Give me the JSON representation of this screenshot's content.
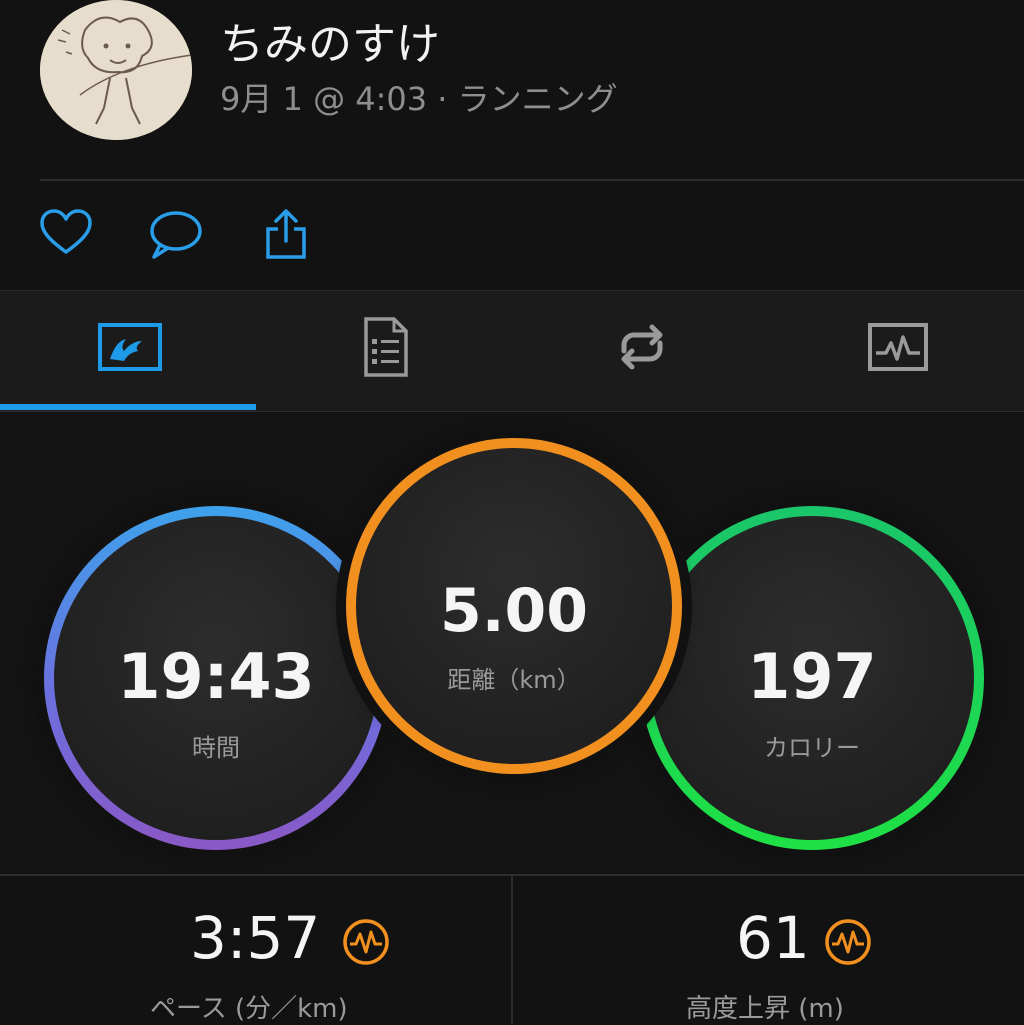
{
  "header": {
    "user_name": "ちみのすけ",
    "meta": "9月 1 @ 4:03 · ランニング"
  },
  "actions": [
    {
      "name": "like",
      "icon": "heart-icon"
    },
    {
      "name": "comment",
      "icon": "speech-bubble-icon"
    },
    {
      "name": "share",
      "icon": "share-icon"
    }
  ],
  "tabs": [
    {
      "name": "overview",
      "icon": "map-icon",
      "active": true
    },
    {
      "name": "details",
      "icon": "document-list-icon",
      "active": false
    },
    {
      "name": "laps",
      "icon": "repeat-icon",
      "active": false
    },
    {
      "name": "charts",
      "icon": "activity-graph-icon",
      "active": false
    }
  ],
  "stats": {
    "time": {
      "value": "19:43",
      "label": "時間",
      "color_start": "#3fa0ea",
      "color_end": "#7a5fd0"
    },
    "distance": {
      "value": "5.00",
      "label": "距離（km）",
      "color": "#f2901f"
    },
    "calories": {
      "value": "197",
      "label": "カロリー",
      "color_start": "#1fd45f",
      "color_end": "#22e43a"
    }
  },
  "bottom": {
    "pace": {
      "value": "3:57",
      "label": "ペース (分／km)",
      "icon": "heart-rate-badge-icon",
      "icon_color": "#f2901f"
    },
    "elevation": {
      "value": "61",
      "label": "高度上昇 (m)",
      "icon": "heart-rate-badge-icon",
      "icon_color": "#f2901f"
    }
  },
  "colors": {
    "accent": "#1e9be8",
    "bg": "#121212"
  }
}
